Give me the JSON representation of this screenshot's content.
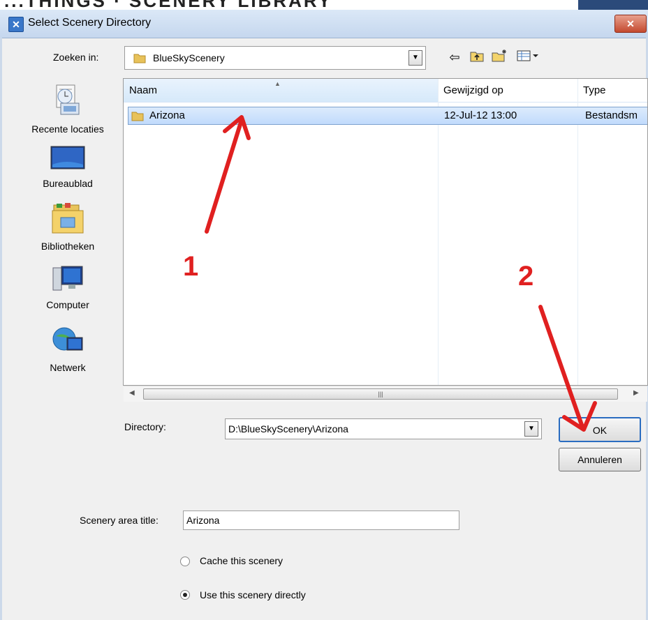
{
  "background_window": {
    "partial_text": "...THINGS · SCENERY LIBRARY"
  },
  "dialog": {
    "title": "Select Scenery Directory",
    "close_label": "✕"
  },
  "lookin": {
    "label": "Zoeken in:",
    "value": "BlueSkyScenery",
    "toolbar_icons": [
      "back-icon",
      "up-folder-icon",
      "new-folder-icon",
      "view-menu-icon"
    ]
  },
  "places": [
    {
      "label": "Recente locaties",
      "icon": "recent-places-icon"
    },
    {
      "label": "Bureaublad",
      "icon": "desktop-icon"
    },
    {
      "label": "Bibliotheken",
      "icon": "libraries-icon"
    },
    {
      "label": "Computer",
      "icon": "computer-icon"
    },
    {
      "label": "Netwerk",
      "icon": "network-icon"
    }
  ],
  "filelist": {
    "columns": [
      "Naam",
      "Gewijzigd op",
      "Type"
    ],
    "rows": [
      {
        "name": "Arizona",
        "modified": "12-Jul-12 13:00",
        "type": "Bestandsm"
      }
    ]
  },
  "directory": {
    "label": "Directory:",
    "value": "D:\\BlueSkyScenery\\Arizona"
  },
  "buttons": {
    "ok": "OK",
    "cancel": "Annuleren"
  },
  "scenery": {
    "title_label": "Scenery area title:",
    "title_value": "Arizona",
    "options": [
      {
        "label": "Cache this scenery",
        "checked": false
      },
      {
        "label": "Use this scenery directly",
        "checked": true
      }
    ]
  },
  "annotations": {
    "step1": "1",
    "step2": "2",
    "arrow_color": "#e02020"
  },
  "colors": {
    "selection": "#c1dbfc",
    "ok_border": "#2a6cc0"
  }
}
